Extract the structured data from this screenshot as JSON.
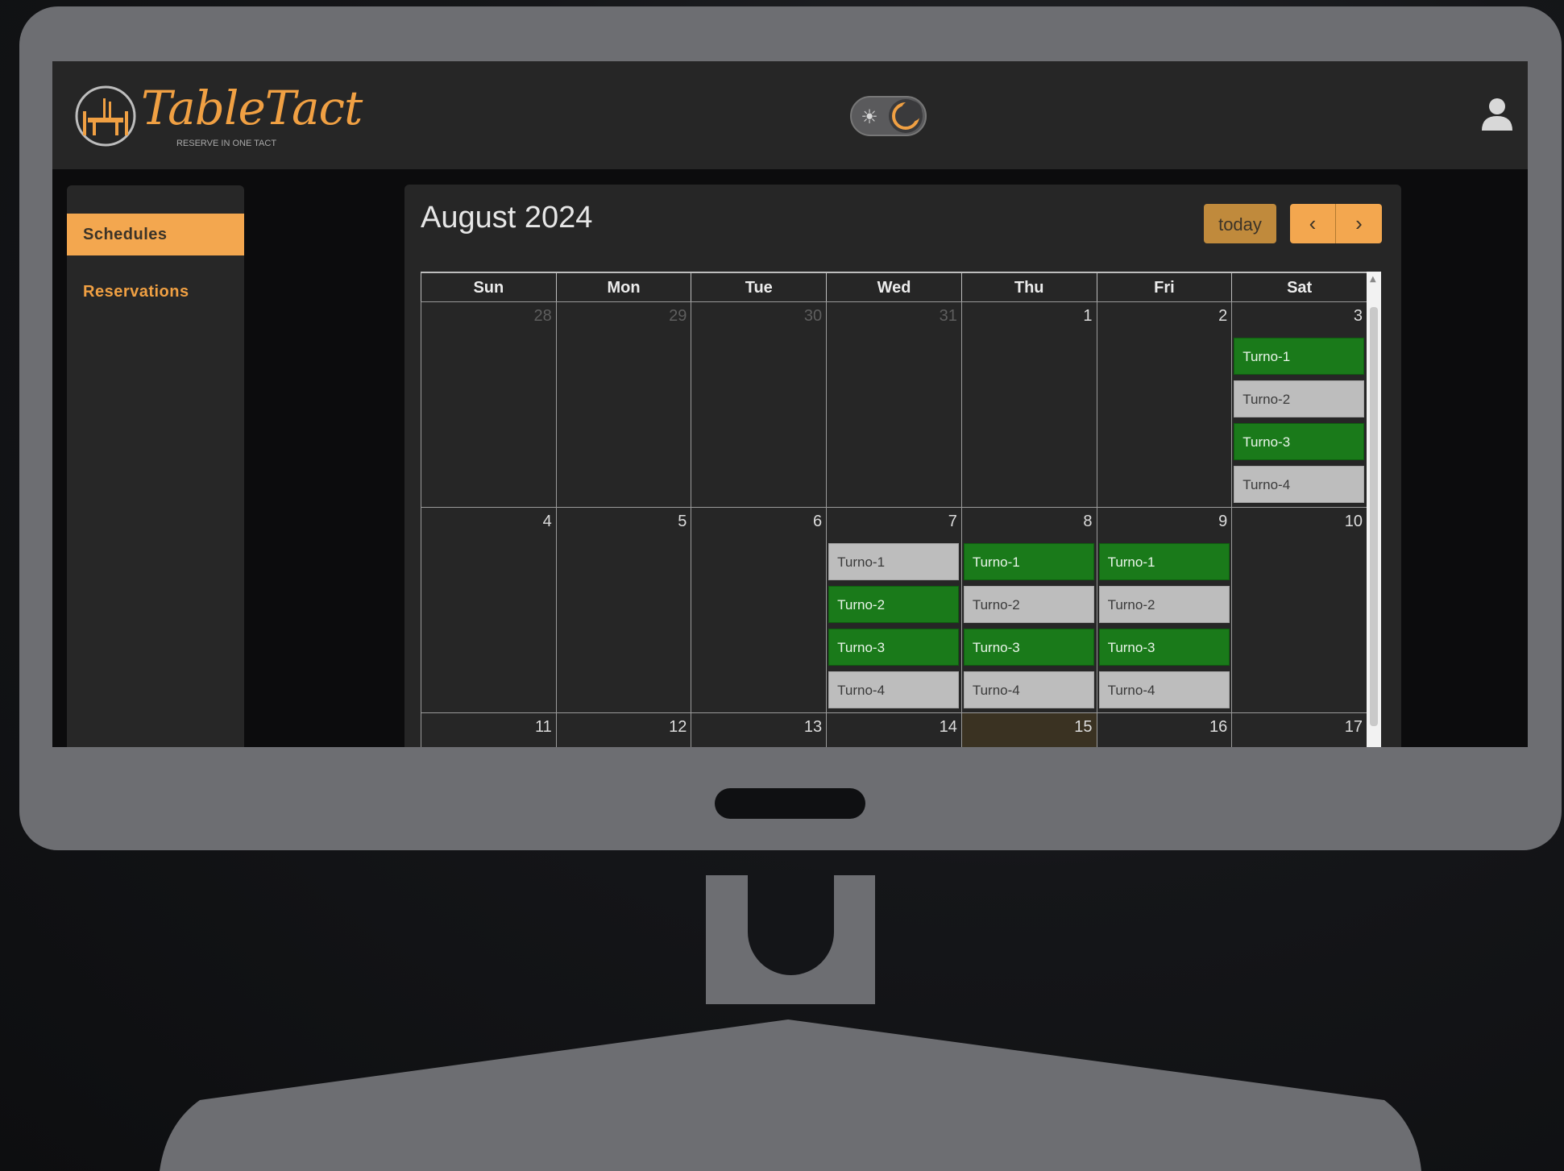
{
  "app": {
    "name": "TableTact",
    "tagline": "RESERVE IN ONE TACT"
  },
  "header": {
    "theme_toggle": {
      "sun_icon": "☀",
      "mode": "dark"
    },
    "user_icon": "user-icon"
  },
  "sidebar": {
    "items": [
      {
        "label": "Schedules",
        "active": true
      },
      {
        "label": "Reservations",
        "active": false
      }
    ]
  },
  "calendar": {
    "title": "August 2024",
    "today_label": "today",
    "prev_label": "‹",
    "next_label": "›",
    "weekdays": [
      "Sun",
      "Mon",
      "Tue",
      "Wed",
      "Thu",
      "Fri",
      "Sat"
    ],
    "weeks": [
      {
        "days": [
          {
            "num": "28",
            "muted": true,
            "events": []
          },
          {
            "num": "29",
            "muted": true,
            "events": []
          },
          {
            "num": "30",
            "muted": true,
            "events": []
          },
          {
            "num": "31",
            "muted": true,
            "events": []
          },
          {
            "num": "1",
            "events": []
          },
          {
            "num": "2",
            "events": []
          },
          {
            "num": "3",
            "events": [
              {
                "label": "Turno-1",
                "status": "green"
              },
              {
                "label": "Turno-2",
                "status": "grey"
              },
              {
                "label": "Turno-3",
                "status": "green"
              },
              {
                "label": "Turno-4",
                "status": "grey"
              }
            ]
          }
        ]
      },
      {
        "days": [
          {
            "num": "4",
            "events": []
          },
          {
            "num": "5",
            "events": []
          },
          {
            "num": "6",
            "events": []
          },
          {
            "num": "7",
            "events": [
              {
                "label": "Turno-1",
                "status": "grey"
              },
              {
                "label": "Turno-2",
                "status": "green"
              },
              {
                "label": "Turno-3",
                "status": "green"
              },
              {
                "label": "Turno-4",
                "status": "grey"
              }
            ]
          },
          {
            "num": "8",
            "events": [
              {
                "label": "Turno-1",
                "status": "green"
              },
              {
                "label": "Turno-2",
                "status": "grey"
              },
              {
                "label": "Turno-3",
                "status": "green"
              },
              {
                "label": "Turno-4",
                "status": "grey"
              }
            ]
          },
          {
            "num": "9",
            "events": [
              {
                "label": "Turno-1",
                "status": "green"
              },
              {
                "label": "Turno-2",
                "status": "grey"
              },
              {
                "label": "Turno-3",
                "status": "green"
              },
              {
                "label": "Turno-4",
                "status": "grey"
              }
            ]
          },
          {
            "num": "10",
            "events": []
          }
        ]
      },
      {
        "days": [
          {
            "num": "11",
            "events": []
          },
          {
            "num": "12",
            "events": []
          },
          {
            "num": "13",
            "events": []
          },
          {
            "num": "14",
            "events": []
          },
          {
            "num": "15",
            "today": true,
            "events": []
          },
          {
            "num": "16",
            "events": []
          },
          {
            "num": "17",
            "events": []
          }
        ]
      }
    ]
  },
  "colors": {
    "accent": "#f3a74f",
    "available": "#1a7a1a",
    "unavailable": "#bdbdbd",
    "background": "#262626"
  }
}
